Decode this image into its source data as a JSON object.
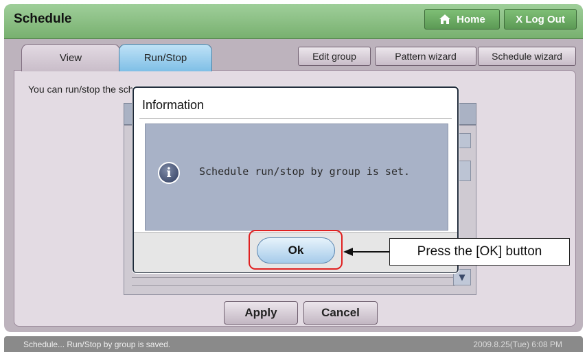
{
  "header": {
    "title": "Schedule",
    "home_label": "Home",
    "logout_label": "X Log Out"
  },
  "tabs": [
    {
      "label": "View"
    },
    {
      "label": "Run/Stop"
    }
  ],
  "actions": {
    "edit_group": "Edit group",
    "pattern_wizard": "Pattern wizard",
    "schedule_wizard": "Schedule wizard"
  },
  "main": {
    "description": "You can run/stop the schedule applied to each group.",
    "apply_label": "Apply",
    "cancel_label": "Cancel"
  },
  "dialog": {
    "title": "Information",
    "message": "Schedule run/stop by group is set.",
    "ok_label": "Ok"
  },
  "annotation": {
    "callout": "Press the [OK] button"
  },
  "statusbar": {
    "message": "Schedule... Run/Stop by group is saved.",
    "datetime": "2009.8.25(Tue)  6:08 PM"
  },
  "colors": {
    "titlebar": "#8cc285",
    "active_tab": "#9fd0ef",
    "highlight": "#e02020"
  }
}
